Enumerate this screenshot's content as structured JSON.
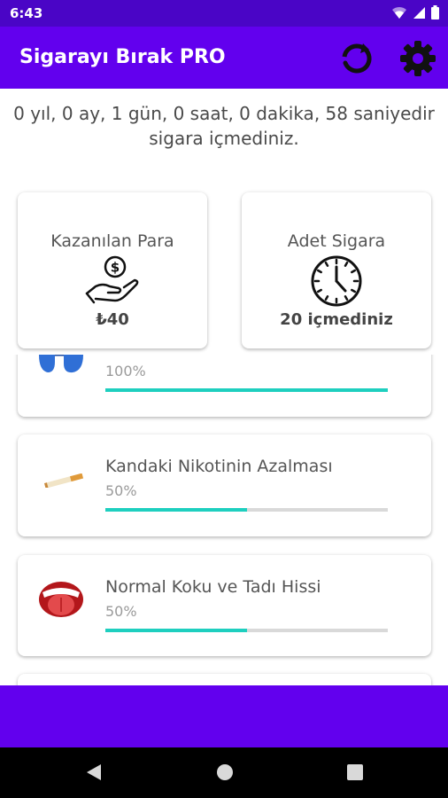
{
  "status_bar": {
    "time": "6:43",
    "icons": [
      "wifi-icon",
      "signal-icon",
      "battery-icon"
    ]
  },
  "app_bar": {
    "title": "Sigarayı Bırak PRO",
    "refresh_icon": "refresh-icon",
    "settings_icon": "gear-icon",
    "background": "#6200ee"
  },
  "elapsed": {
    "line1": "0 yıl, 0 ay, 1 gün, 0 saat, 0 dakika, 58 saniyedir",
    "line2": "sigara içmediniz."
  },
  "stats": [
    {
      "label": "Kazanılan Para",
      "value": "₺40",
      "icon": "money-hand-icon"
    },
    {
      "label": "Adet Sigara",
      "value": "20 içmediniz",
      "icon": "clock-icon"
    }
  ],
  "progress_items": [
    {
      "title": "",
      "percent_label": "100%",
      "progress": 1.0,
      "icon": "lungs-icon"
    },
    {
      "title": "Kandaki Nikotinin Azalması",
      "percent_label": "50%",
      "progress": 0.5,
      "icon": "cigarette-icon"
    },
    {
      "title": "Normal Koku ve Tadı Hissi",
      "percent_label": "50%",
      "progress": 0.5,
      "icon": "mouth-tongue-icon"
    }
  ],
  "nav": {
    "back_icon": "back-icon",
    "home_icon": "home-icon",
    "recents_icon": "recents-icon"
  },
  "colors": {
    "accent": "#6200ee",
    "status_bar": "#4a05c6",
    "progress": "#1ecfbf",
    "track": "#d9d9d9"
  }
}
